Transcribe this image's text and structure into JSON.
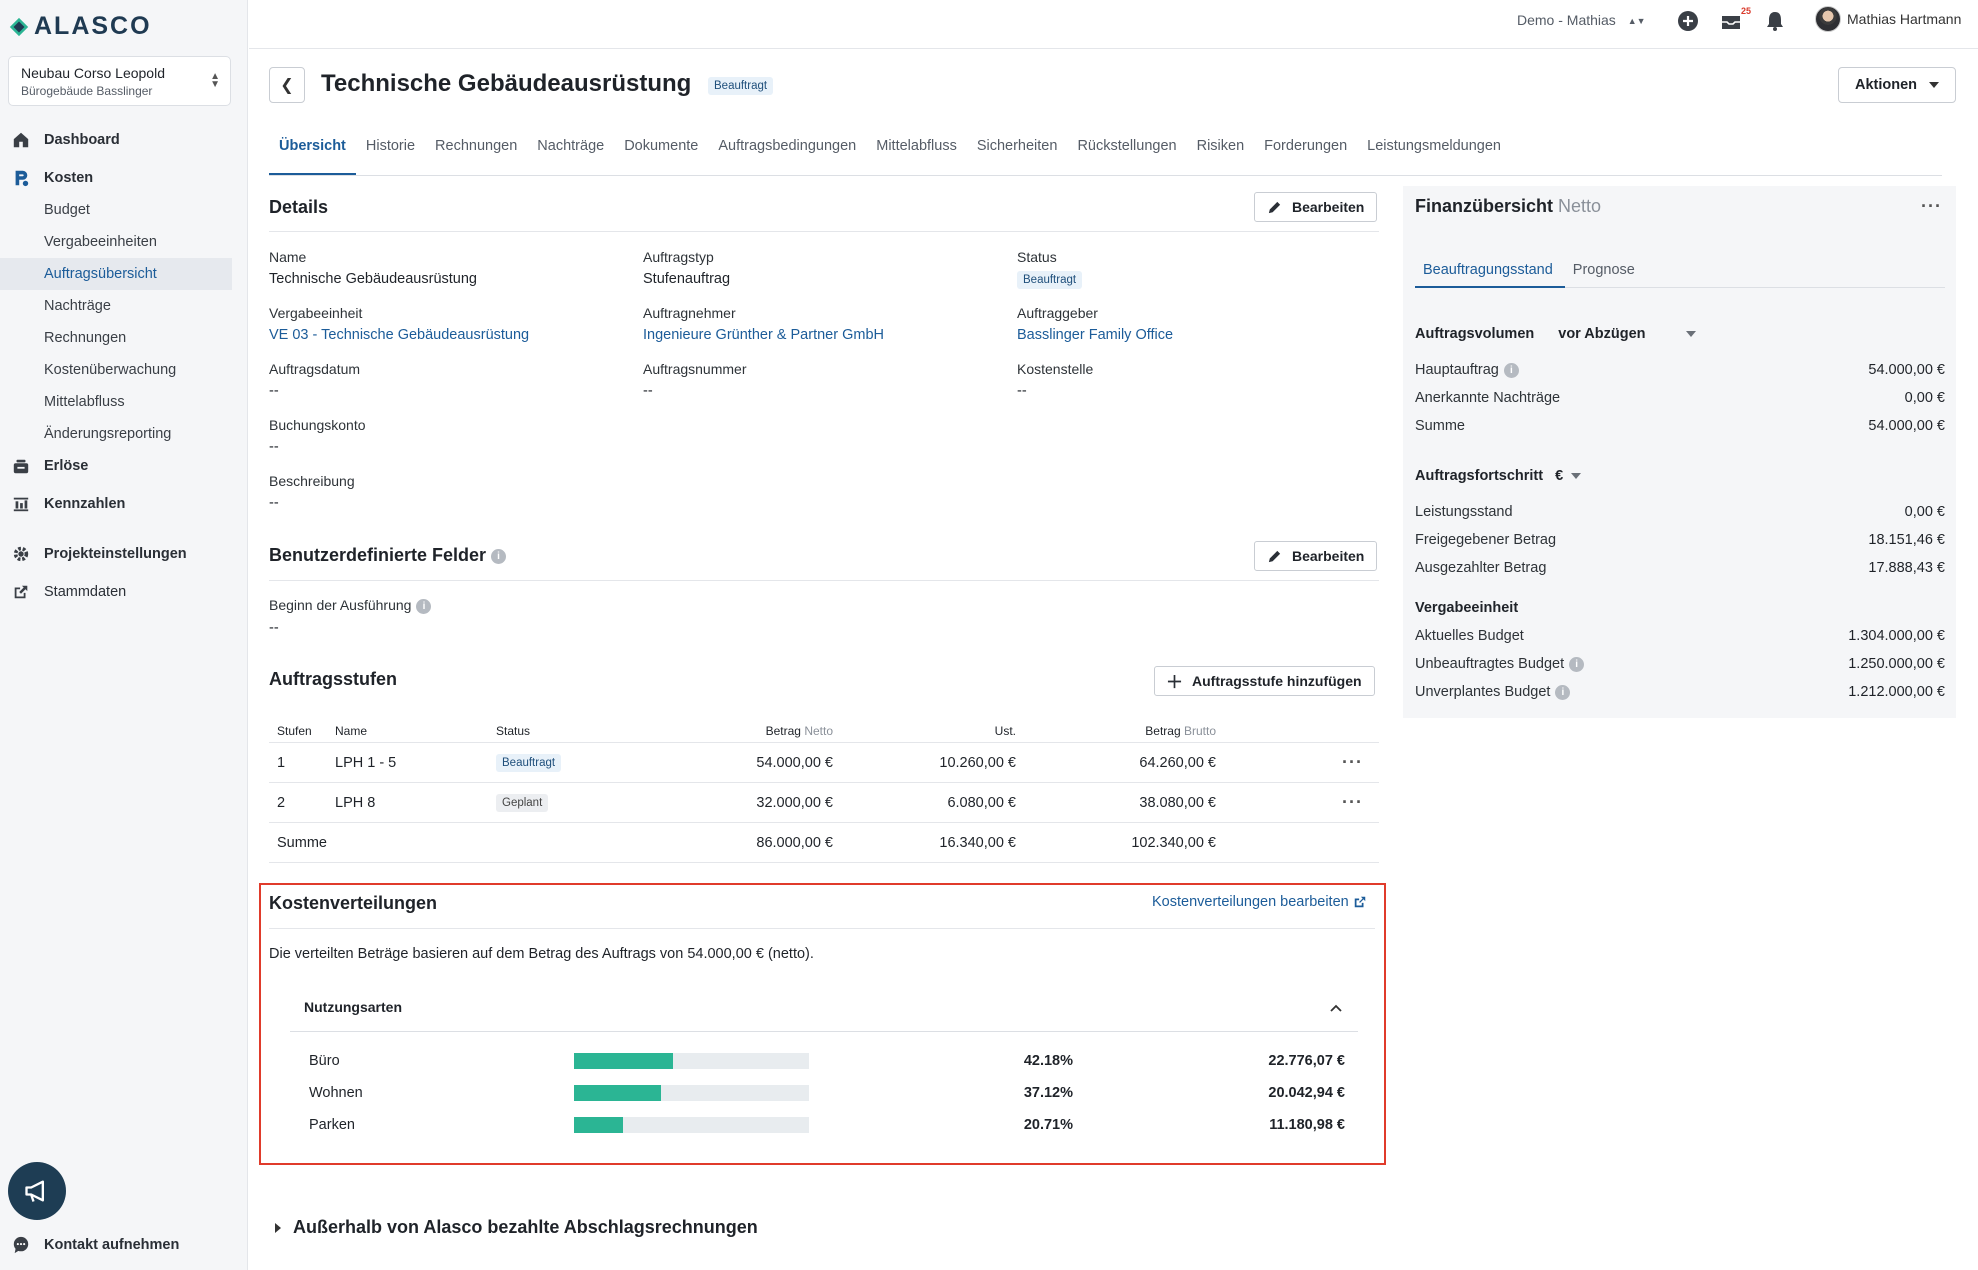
{
  "app": {
    "logo_text": "ALASCO"
  },
  "project": {
    "name": "Neubau Corso Leopold",
    "subtitle": "Bürogebäude Basslinger"
  },
  "sidebar": {
    "dashboard": "Dashboard",
    "kosten": "Kosten",
    "kosten_items": [
      "Budget",
      "Vergabeeinheiten",
      "Auftragsübersicht",
      "Nachträge",
      "Rechnungen",
      "Kostenüberwachung",
      "Mittelabfluss",
      "Änderungsreporting"
    ],
    "erloese": "Erlöse",
    "kennzahlen": "Kennzahlen",
    "projekteinstellungen": "Projekteinstellungen",
    "stammdaten": "Stammdaten",
    "contact": "Kontakt aufnehmen"
  },
  "topbar": {
    "demo": "Demo - Mathias",
    "notif_count": "25",
    "user": "Mathias Hartmann"
  },
  "header": {
    "title": "Technische Gebäudeausrüstung",
    "status_tag": "Beauftragt",
    "actions": "Aktionen"
  },
  "tabs": [
    "Übersicht",
    "Historie",
    "Rechnungen",
    "Nachträge",
    "Dokumente",
    "Auftragsbedingungen",
    "Mittelabfluss",
    "Sicherheiten",
    "Rückstellungen",
    "Risiken",
    "Forderungen",
    "Leistungsmeldungen"
  ],
  "details": {
    "title": "Details",
    "edit": "Bearbeiten",
    "name_label": "Name",
    "name": "Technische Gebäudeausrüstung",
    "type_label": "Auftragstyp",
    "type": "Stufenauftrag",
    "status_label": "Status",
    "status": "Beauftragt",
    "ve_label": "Vergabeeinheit",
    "ve": "VE 03 - Technische Gebäudeausrüstung",
    "contractor_label": "Auftragnehmer",
    "contractor": "Ingenieure Grünther & Partner GmbH",
    "client_label": "Auftraggeber",
    "client": "Basslinger Family Office",
    "date_label": "Auftragsdatum",
    "date": "--",
    "number_label": "Auftragsnummer",
    "number": "--",
    "costcenter_label": "Kostenstelle",
    "costcenter": "--",
    "account_label": "Buchungskonto",
    "account": "--",
    "description_label": "Beschreibung",
    "description": "--"
  },
  "custom_fields": {
    "title": "Benutzerdefinierte Felder",
    "edit": "Bearbeiten",
    "start_label": "Beginn der Ausführung",
    "start": "--"
  },
  "stufen": {
    "title": "Auftragsstufen",
    "add": "Auftragsstufe hinzufügen",
    "headers": {
      "stufe": "Stufen",
      "name": "Name",
      "status": "Status",
      "betrag": "Betrag",
      "netto": "Netto",
      "ust": "Ust.",
      "brutto": "Brutto"
    },
    "rows": [
      {
        "stufe": "1",
        "name": "LPH 1 - 5",
        "status": "Beauftragt",
        "netto": "54.000,00 €",
        "ust": "10.260,00 €",
        "brutto": "64.260,00 €"
      },
      {
        "stufe": "2",
        "name": "LPH 8",
        "status": "Geplant",
        "netto": "32.000,00 €",
        "ust": "6.080,00 €",
        "brutto": "38.080,00 €"
      }
    ],
    "sum": {
      "label": "Summe",
      "netto": "86.000,00 €",
      "ust": "16.340,00 €",
      "brutto": "102.340,00 €"
    }
  },
  "kostenverteilungen": {
    "title": "Kostenverteilungen",
    "edit_link": "Kostenverteilungen bearbeiten",
    "info": "Die verteilten Beträge basieren auf dem Betrag des Auftrags von 54.000,00 € (netto).",
    "group": "Nutzungsarten",
    "items": [
      {
        "label": "Büro",
        "percent": "42.18%",
        "fraction": 0.4218,
        "amount": "22.776,07 €"
      },
      {
        "label": "Wohnen",
        "percent": "37.12%",
        "fraction": 0.3712,
        "amount": "20.042,94 €"
      },
      {
        "label": "Parken",
        "percent": "20.71%",
        "fraction": 0.2071,
        "amount": "11.180,98 €"
      }
    ],
    "bar_color": "#2bb594"
  },
  "external": {
    "title": "Außerhalb von Alasco bezahlte Abschlagsrechnungen"
  },
  "finance": {
    "title": "Finanzübersicht",
    "title_suffix": "Netto",
    "tabs": [
      "Beauftragungsstand",
      "Prognose"
    ],
    "volume_label": "Auftragsvolumen",
    "volume_select": "vor Abzügen",
    "rows1": [
      {
        "label": "Hauptauftrag",
        "value": "54.000,00 €"
      },
      {
        "label": "Anerkannte Nachträge",
        "value": "0,00 €"
      },
      {
        "label": "Summe",
        "value": "54.000,00 €"
      }
    ],
    "progress_label": "Auftragsfortschritt",
    "progress_select": "€",
    "rows2": [
      {
        "label": "Leistungsstand",
        "value": "0,00 €"
      },
      {
        "label": "Freigegebener Betrag",
        "value": "18.151,46 €"
      },
      {
        "label": "Ausgezahlter Betrag",
        "value": "17.888,43 €"
      }
    ],
    "ve_label": "Vergabeeinheit",
    "rows3": [
      {
        "label": "Aktuelles Budget",
        "value": "1.304.000,00 €"
      },
      {
        "label": "Unbeauftragtes Budget",
        "value": "1.250.000,00 €"
      },
      {
        "label": "Unverplantes Budget",
        "value": "1.212.000,00 €"
      }
    ]
  },
  "colors": {
    "accent": "#1c5c99",
    "highlight_border": "#e03b2b",
    "sidebar_bg": "#f5f6f8"
  }
}
